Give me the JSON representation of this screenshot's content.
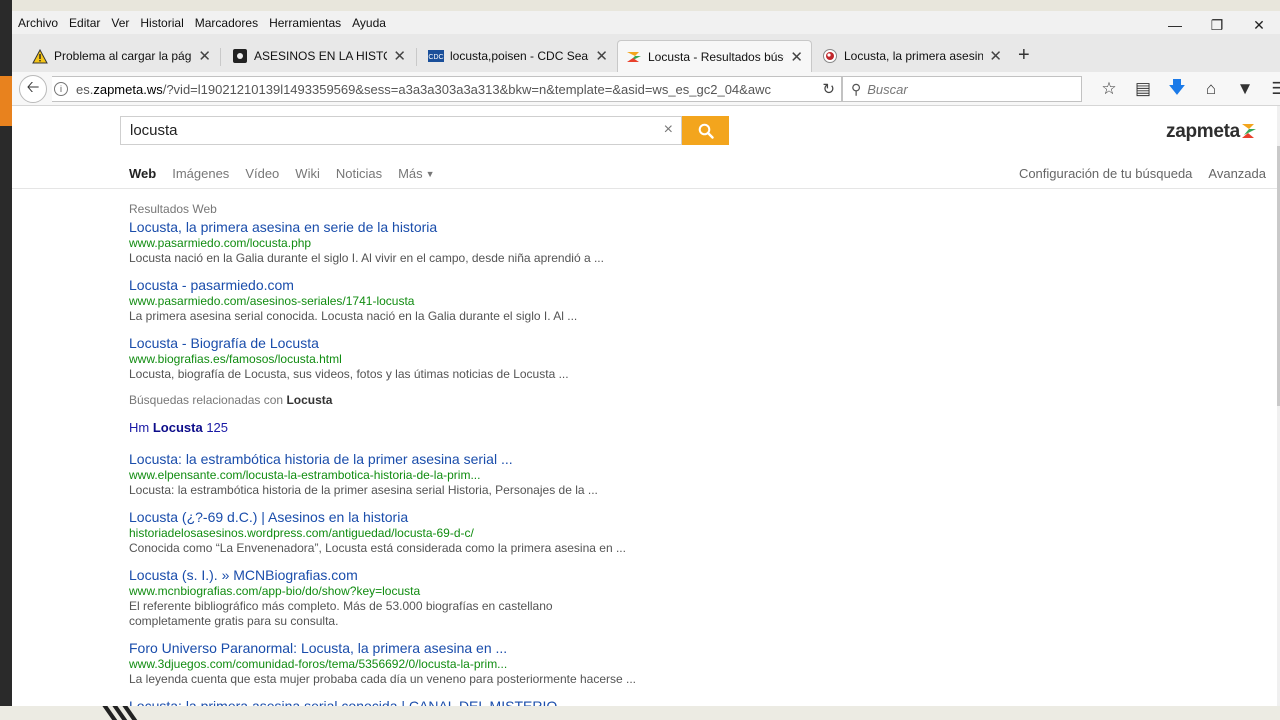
{
  "menu": [
    "Archivo",
    "Editar",
    "Ver",
    "Historial",
    "Marcadores",
    "Herramientas",
    "Ayuda"
  ],
  "tabs": [
    {
      "title": "Problema al cargar la página",
      "icon": "warning-icon"
    },
    {
      "title": "ASESINOS EN LA HISTORIA...",
      "icon": "site-favicon"
    },
    {
      "title": "locusta,poisen - CDC Search",
      "icon": "cdc-favicon"
    },
    {
      "title": "Locusta - Resultados búsqu",
      "icon": "zapmeta-favicon"
    },
    {
      "title": "Locusta, la primera asesina e",
      "icon": "site-favicon"
    }
  ],
  "url": {
    "prefix": "es.",
    "host": "zapmeta.ws",
    "rest": "/?vid=l19021210139l1493359569&sess=a3a3a303a3a313&bkw=n&template=&asid=ws_es_gc2_04&awc"
  },
  "browser_search_placeholder": "Buscar",
  "search": {
    "query": "locusta",
    "clear": "×"
  },
  "logo": "zapmeta",
  "nav_tabs": [
    "Web",
    "Imágenes",
    "Vídeo",
    "Wiki",
    "Noticias",
    "Más"
  ],
  "nav_right": [
    "Configuración de tu búsqueda",
    "Avanzada"
  ],
  "results_label": "Resultados Web",
  "results_top": [
    {
      "title": "Locusta, la primera asesina en serie de la historia",
      "url": "www.pasarmiedo.com/locusta.php",
      "snippet": "Locusta nació en la Galia durante el siglo I. Al vivir en el campo, desde niña aprendió a ..."
    },
    {
      "title": "Locusta - pasarmiedo.com",
      "url": "www.pasarmiedo.com/asesinos-seriales/1741-locusta",
      "snippet": "La primera asesina serial conocida. Locusta nació en la Galia durante el siglo I. Al ..."
    },
    {
      "title": "Locusta - Biografía de Locusta",
      "url": "www.biografias.es/famosos/locusta.html",
      "snippet": "Locusta, biografía de Locusta, sus videos, fotos y las útimas noticias de Locusta ..."
    }
  ],
  "related": {
    "label": "Búsquedas relacionadas con",
    "term": "Locusta",
    "link_pre": "Hm",
    "link_term": "Locusta",
    "link_post": "125"
  },
  "results_bottom": [
    {
      "title": "Locusta: la estrambótica historia de la primer asesina serial ...",
      "url": "www.elpensante.com/locusta-la-estrambotica-historia-de-la-prim...",
      "snippet": "Locusta: la estrambótica historia de la primer asesina serial Historia, Personajes de la ..."
    },
    {
      "title": "Locusta (¿?-69 d.C.) | Asesinos en la historia",
      "url": "historiadelosasesinos.wordpress.com/antiguedad/locusta-69-d-c/",
      "snippet": "Conocida como “La Envenenadora”, Locusta está considerada como la primera asesina en ..."
    },
    {
      "title": "Locusta (s. I.). » MCNBiografias.com",
      "url": "www.mcnbiografias.com/app-bio/do/show?key=locusta",
      "snippet": "El referente bibliográfico más completo. Más de 53.000 biografías en castellano completamente gratis para su consulta."
    },
    {
      "title": "Foro Universo Paranormal: Locusta, la primera asesina en ...",
      "url": "www.3djuegos.com/comunidad-foros/tema/5356692/0/locusta-la-prim...",
      "snippet": "La leyenda cuenta que esta mujer probaba cada día un veneno para posteriormente hacerse ..."
    },
    {
      "title": "Locusta: la primera asesina serial conocida | CANAL DEL MISTERIO",
      "url": "",
      "snippet": ""
    }
  ]
}
